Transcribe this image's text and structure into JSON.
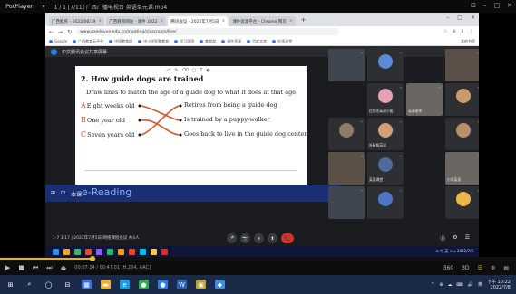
{
  "player": {
    "app_name": "PotPlayer",
    "menu": "▾",
    "file_title": "1 / 1 [7/11] 广西广播电视台 英语单元课.mp4",
    "progress": 0.18,
    "time_text": "00:07:14 / 00:47:01  [H.264, AAC]",
    "window_buttons": [
      "⊡",
      "–",
      "□",
      "✕"
    ],
    "controls": [
      "▶",
      "■",
      "⏮",
      "⏭",
      "⏏"
    ],
    "right_controls": [
      "360",
      "3D",
      "☰",
      "⚙",
      "▤"
    ]
  },
  "browser": {
    "tabs": [
      {
        "label": "广西教育 - 2022/06/19",
        "active": false
      },
      {
        "label": "广西教育网站 - 课件 2022",
        "active": false
      },
      {
        "label": "腾讯会议 - 2022年7月5日",
        "active": true
      },
      {
        "label": "课件资源平台 - Chrome 网页",
        "active": false
      }
    ],
    "new_tab": "+",
    "window_buttons": [
      "–",
      "□",
      "✕"
    ],
    "nav": [
      "←",
      "→",
      "↻"
    ],
    "url": "www.gxeduyun.edu.cn/meeting/classroom/live/",
    "ext_icons": [
      "☆",
      "⊕",
      "⬇",
      "⋮"
    ],
    "bookmarks": [
      "Google",
      "广西教育云平台",
      "中国教育网",
      "中小学智慧教育",
      "学习强国",
      "教育部",
      "课件资源",
      "百度文库",
      "在线课堂"
    ],
    "bookmark_last": "其他书签"
  },
  "meeting": {
    "title": "中文腾讯会议共享屏幕",
    "slide": {
      "heading": "2. How guide dogs are trained",
      "instruction": "Draw lines to match the age of a guide dog to what it does at that age.",
      "rows": [
        {
          "letter": "A",
          "left": "Eight weeks old",
          "right": "Retires from being a guide dog"
        },
        {
          "letter": "B",
          "left": "One year old",
          "right": "Is trained by a puppy-walker"
        },
        {
          "letter": "C",
          "left": "Seven years old",
          "right": "Goes back to live in the guide dog center"
        }
      ],
      "toolbar": [
        "⤺",
        "✎",
        "⌫",
        "▢",
        "T",
        "◐"
      ]
    },
    "caption": "e-Reading",
    "caption_icons": [
      "⊞",
      "⊡",
      "本课"
    ],
    "participants": [
      {
        "name": "",
        "style": "cam3"
      },
      {
        "name": "",
        "style": "avatar",
        "color": "#5b8bd6"
      },
      {
        "name": "",
        "style": "cam"
      },
      {
        "name": "红领巾英语小组",
        "style": "avatar",
        "color": "#e5a0b2"
      },
      {
        "name": "英语老师",
        "style": "cam2"
      },
      {
        "name": "",
        "style": "avatar",
        "color": "#c99a6b"
      },
      {
        "name": "",
        "style": "avatar",
        "color": "#8f7c67"
      },
      {
        "name": "外研版英语",
        "style": "avatar",
        "color": "#d3a073"
      },
      {
        "name": "",
        "style": "avatar",
        "color": "#b98f67"
      },
      {
        "name": "",
        "style": "cam"
      },
      {
        "name": "英语课堂",
        "style": "avatar",
        "color": "#4f6b9c"
      },
      {
        "name": "小学英语",
        "style": "cam2"
      },
      {
        "name": "",
        "style": "cam3"
      },
      {
        "name": "",
        "style": "avatar",
        "color": "#4e76c8"
      },
      {
        "name": "",
        "style": "avatar",
        "color": "#eab54c"
      }
    ],
    "time": "1-7 3:17  |  2022年7月5日 网络课程会议 共4人",
    "controls": [
      "🎤",
      "📷",
      "⏸",
      "⬆",
      "📞"
    ],
    "right_controls": [
      "⓪",
      "⚙",
      "☰"
    ]
  },
  "inner_taskbar": {
    "icon_colors": [
      "#2d8cf0",
      "#f5a623",
      "#3cb371",
      "#e04a2b",
      "#8a5cf6",
      "#19be6b",
      "#ff9900",
      "#ed4014",
      "#00c1de",
      "#f7c948",
      "#d93025"
    ],
    "tray_text": "⊞ 中 英 ⊙ ⌂ 2022/7/5"
  },
  "host_taskbar": {
    "icons": [
      {
        "name": "start",
        "glyph": "⊞",
        "color": "transparent"
      },
      {
        "name": "search",
        "glyph": "⌕",
        "color": "transparent"
      },
      {
        "name": "task-view",
        "glyph": "◯",
        "color": "transparent"
      },
      {
        "name": "widgets",
        "glyph": "⊟",
        "color": "transparent"
      },
      {
        "name": "files",
        "glyph": "▦",
        "color": "#3a6de0"
      },
      {
        "name": "explorer",
        "glyph": "▬",
        "color": "#e9b13b"
      },
      {
        "name": "edge",
        "glyph": "e",
        "color": "#1a9be6"
      },
      {
        "name": "chrome",
        "glyph": "●",
        "color": "#2fa84f"
      },
      {
        "name": "app-1",
        "glyph": "●",
        "color": "#2b7de9"
      },
      {
        "name": "app-2",
        "glyph": "W",
        "color": "#2b5fb8"
      },
      {
        "name": "app-3",
        "glyph": "▣",
        "color": "#b9a23a"
      },
      {
        "name": "app-4",
        "glyph": "◆",
        "color": "#3a8de0"
      }
    ],
    "tray": [
      "^",
      "⊕",
      "☁",
      "⌨",
      "🔊",
      "英"
    ],
    "clock_time": "下午 10:22",
    "clock_date": "2022/7/8"
  }
}
